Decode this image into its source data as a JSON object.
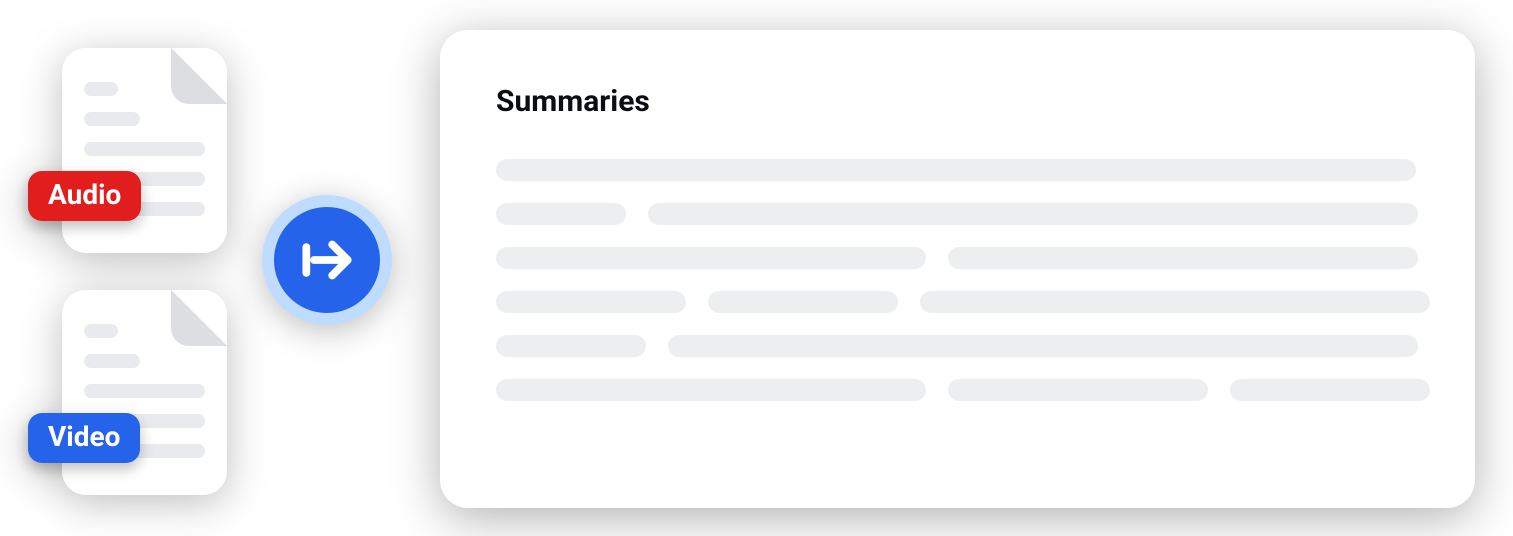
{
  "inputs": [
    {
      "badge": "Audio",
      "badge_color": "red"
    },
    {
      "badge": "Video",
      "badge_color": "blue"
    }
  ],
  "arrow": {
    "icon": "arrow-right-from-line"
  },
  "output": {
    "title": "Summaries",
    "placeholder_rows": [
      [
        920
      ],
      [
        130,
        770
      ],
      [
        430,
        470
      ],
      [
        190,
        190,
        510
      ],
      [
        150,
        750
      ],
      [
        430,
        260,
        200
      ]
    ]
  },
  "colors": {
    "blue": "#2563eb",
    "blue_light": "#bfdbfe",
    "red": "#e11d1d",
    "placeholder": "#edeef0"
  }
}
